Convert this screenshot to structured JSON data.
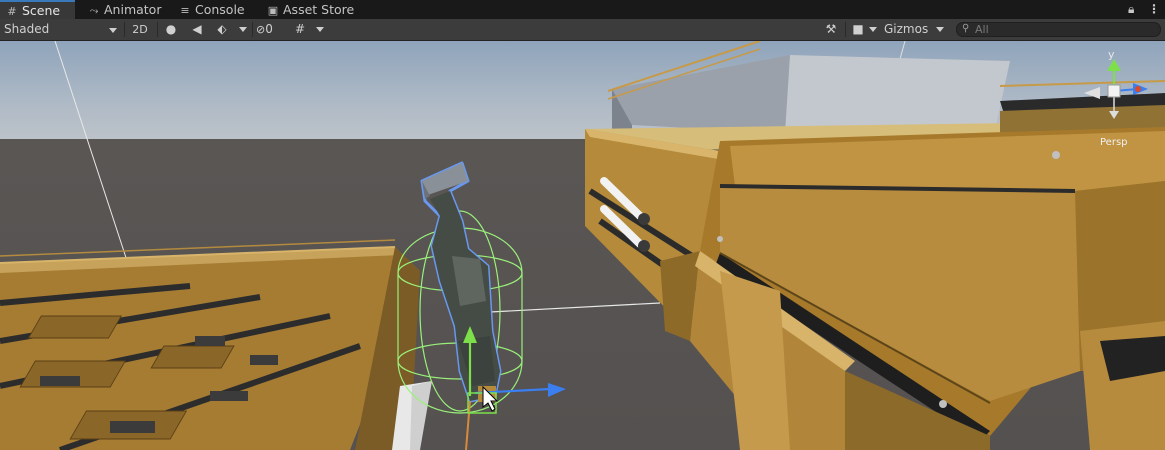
{
  "tabs": [
    {
      "label": "Scene",
      "icon": "grid-icon",
      "active": true
    },
    {
      "label": "Animator",
      "icon": "animator-icon",
      "active": false
    },
    {
      "label": "Console",
      "icon": "console-icon",
      "active": false
    },
    {
      "label": "Asset Store",
      "icon": "shopping-bag-icon",
      "active": false
    }
  ],
  "window_controls": {
    "lock": "lock-icon",
    "menu": "kebab-menu-icon"
  },
  "toolbar": {
    "draw_mode": "Shaded",
    "mode_2d": "2D",
    "hidden_count": "0",
    "gizmos": "Gizmos",
    "search_placeholder": "All"
  },
  "gizmo": {
    "axis_label": "y",
    "projection": "Persp"
  },
  "colors": {
    "selection_outline": "#6aa0ff",
    "collider": "#9af07a",
    "axis_y": "#7de04a",
    "axis_z": "#3a7ef0",
    "axis_x": "#d84a2a",
    "tab_accent": "#3a79bb"
  }
}
